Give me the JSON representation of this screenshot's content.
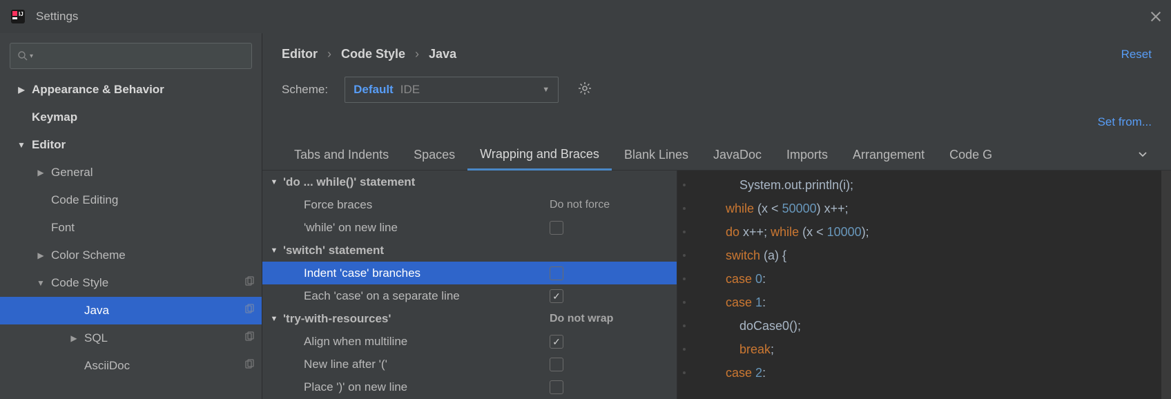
{
  "window": {
    "title": "Settings"
  },
  "search": {
    "placeholder": ""
  },
  "sidebar": [
    {
      "label": "Appearance & Behavior",
      "arrow": "▶",
      "bold": true
    },
    {
      "label": "Keymap",
      "arrow": "",
      "bold": true
    },
    {
      "label": "Editor",
      "arrow": "▼",
      "bold": true
    },
    {
      "label": "General",
      "arrow": "▶",
      "indent": 1
    },
    {
      "label": "Code Editing",
      "arrow": "",
      "indent": 1
    },
    {
      "label": "Font",
      "arrow": "",
      "indent": 1
    },
    {
      "label": "Color Scheme",
      "arrow": "▶",
      "indent": 1
    },
    {
      "label": "Code Style",
      "arrow": "▼",
      "indent": 1,
      "copy": true
    },
    {
      "label": "Java",
      "arrow": "",
      "indent": 2,
      "copy": true,
      "selected": true
    },
    {
      "label": "SQL",
      "arrow": "▶",
      "indent": 2,
      "copy": true
    },
    {
      "label": "AsciiDoc",
      "arrow": "",
      "indent": 2,
      "copy": true
    }
  ],
  "breadcrumb": {
    "a": "Editor",
    "b": "Code Style",
    "c": "Java",
    "reset": "Reset"
  },
  "scheme": {
    "label": "Scheme:",
    "value": "Default",
    "tag": "IDE"
  },
  "setfrom": "Set from...",
  "tabs": [
    "Tabs and Indents",
    "Spaces",
    "Wrapping and Braces",
    "Blank Lines",
    "JavaDoc",
    "Imports",
    "Arrangement",
    "Code G"
  ],
  "tabs_active": 2,
  "options": [
    {
      "type": "group",
      "label": "'do ... while()' statement"
    },
    {
      "type": "child",
      "label": "Force braces",
      "val": "Do not force"
    },
    {
      "type": "child",
      "label": "'while' on new line",
      "check": false
    },
    {
      "type": "group",
      "label": "'switch' statement"
    },
    {
      "type": "child",
      "label": "Indent 'case' branches",
      "check": false,
      "selected": true
    },
    {
      "type": "child",
      "label": "Each 'case' on a separate line",
      "check": true
    },
    {
      "type": "group",
      "label": "'try-with-resources'",
      "val": "Do not wrap"
    },
    {
      "type": "child",
      "label": "Align when multiline",
      "check": true
    },
    {
      "type": "child",
      "label": "New line after '('",
      "check": false
    },
    {
      "type": "child",
      "label": "Place ')' on new line",
      "check": false
    }
  ],
  "code": {
    "l1a": "            System.out.println(i);",
    "l2a": "        ",
    "l2b": "while",
    "l2c": " (x < ",
    "l2d": "50000",
    "l2e": ") x++;",
    "l3a": "        ",
    "l3b": "do",
    "l3c": " x++; ",
    "l3d": "while",
    "l3e": " (x < ",
    "l3f": "10000",
    "l3g": ");",
    "l4a": "        ",
    "l4b": "switch",
    "l4c": " (a) {",
    "l5a": "        ",
    "l5b": "case ",
    "l5c": "0",
    "l5d": ":",
    "l6a": "        ",
    "l6b": "case ",
    "l6c": "1",
    "l6d": ":",
    "l7a": "            doCase0();",
    "l8a": "            ",
    "l8b": "break",
    "l8c": ";",
    "l9a": "        ",
    "l9b": "case ",
    "l9c": "2",
    "l9d": ":"
  }
}
